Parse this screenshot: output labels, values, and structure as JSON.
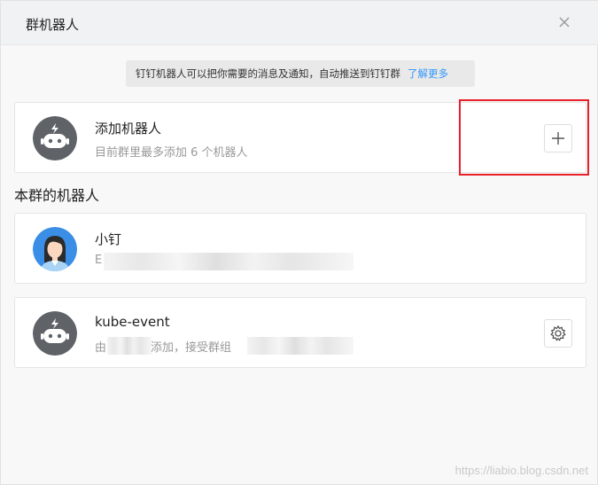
{
  "header": {
    "title": "群机器人"
  },
  "notice": {
    "text": "钉钉机器人可以把你需要的消息及通知，自动推送到钉钉群",
    "link": "了解更多"
  },
  "add_robot": {
    "name": "添加机器人",
    "desc": "目前群里最多添加 6 个机器人"
  },
  "section": {
    "title": "本群的机器人"
  },
  "robots": [
    {
      "name": "小钉",
      "desc": "E"
    },
    {
      "name": "kube-event",
      "desc": "由",
      "desc_tail": "添加，接受群组"
    }
  ],
  "watermark": "https://liabio.blog.csdn.net",
  "colors": {
    "link": "#3296fa",
    "highlight_box": "#e8202a",
    "robot_avatar": "#5f6368"
  }
}
